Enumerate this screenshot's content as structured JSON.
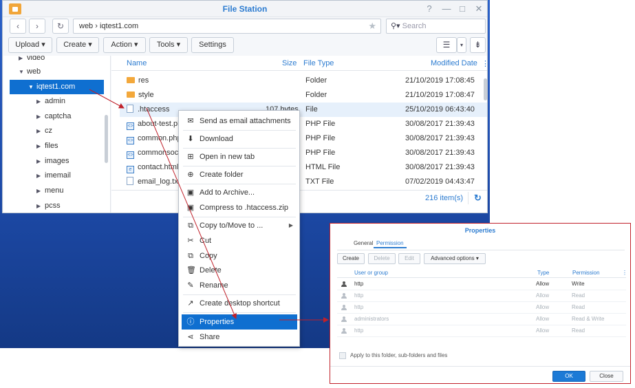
{
  "window": {
    "title": "File Station",
    "controls": [
      "?",
      "—",
      "□",
      "✕"
    ]
  },
  "nav": {
    "back_icon": "chevron-left-icon",
    "forward_icon": "chevron-right-icon",
    "refresh_icon": "refresh-icon",
    "path": "web  ›  iqtest1.com",
    "search_placeholder": "Search"
  },
  "toolbar": {
    "upload": "Upload ▾",
    "create": "Create ▾",
    "action": "Action ▾",
    "tools": "Tools ▾",
    "settings": "Settings"
  },
  "sidebar": {
    "items": [
      {
        "label": "video",
        "level": 1,
        "expanded": false
      },
      {
        "label": "web",
        "level": 1,
        "expanded": true
      },
      {
        "label": "iqtest1.com",
        "level": 2,
        "expanded": true,
        "selected": true
      },
      {
        "label": "admin",
        "level": 3
      },
      {
        "label": "captcha",
        "level": 3
      },
      {
        "label": "cz",
        "level": 3
      },
      {
        "label": "files",
        "level": 3
      },
      {
        "label": "images",
        "level": 3
      },
      {
        "label": "imemail",
        "level": 3
      },
      {
        "label": "menu",
        "level": 3
      },
      {
        "label": "pcss",
        "level": 3
      }
    ]
  },
  "filelist": {
    "headers": {
      "name": "Name",
      "size": "Size",
      "type": "File Type",
      "modified": "Modified Date"
    },
    "rows": [
      {
        "name": "res",
        "size": "",
        "type": "Folder",
        "modified": "21/10/2019 17:08:45",
        "icon": "folder-icon"
      },
      {
        "name": "style",
        "size": "",
        "type": "Folder",
        "modified": "21/10/2019 17:08:47",
        "icon": "folder-icon"
      },
      {
        "name": ".htaccess",
        "size": "107 bytes",
        "type": "File",
        "modified": "25/10/2019 06:43:40",
        "icon": "file-icon",
        "highlighted": true
      },
      {
        "name": "about-test.php",
        "size": "",
        "type": "PHP File",
        "modified": "30/08/2017 21:39:43",
        "icon": "php-file-icon"
      },
      {
        "name": "common.php",
        "size": "",
        "type": "PHP File",
        "modified": "30/08/2017 21:39:43",
        "icon": "php-file-icon"
      },
      {
        "name": "commonsocial",
        "size": "",
        "type": "PHP File",
        "modified": "30/08/2017 21:39:43",
        "icon": "php-file-icon"
      },
      {
        "name": "contact.html",
        "size": "",
        "type": "HTML File",
        "modified": "30/08/2017 21:39:43",
        "icon": "html-file-icon"
      },
      {
        "name": "email_log.txt",
        "size": "",
        "type": "TXT File",
        "modified": "07/02/2019 04:43:47",
        "icon": "text-file-icon"
      }
    ],
    "count": "216 item(s)"
  },
  "context_menu": {
    "items": [
      {
        "label": "Send as email attachments",
        "icon": "mail-icon"
      },
      {
        "label": "Download",
        "icon": "download-icon"
      },
      {
        "label": "Open in new tab",
        "icon": "new-tab-icon"
      },
      {
        "label": "Create folder",
        "icon": "add-folder-icon"
      },
      {
        "label": "Add to Archive...",
        "icon": "archive-icon"
      },
      {
        "label": "Compress to .htaccess.zip",
        "icon": "compress-icon"
      },
      {
        "label": "Copy to/Move to ...",
        "icon": "copy-move-icon",
        "submenu": true
      },
      {
        "label": "Cut",
        "icon": "cut-icon"
      },
      {
        "label": "Copy",
        "icon": "copy-icon"
      },
      {
        "label": "Delete",
        "icon": "delete-icon"
      },
      {
        "label": "Rename",
        "icon": "rename-icon"
      },
      {
        "label": "Create desktop shortcut",
        "icon": "shortcut-icon"
      },
      {
        "label": "Properties",
        "icon": "info-icon",
        "selected": true
      },
      {
        "label": "Share",
        "icon": "share-icon"
      }
    ]
  },
  "properties": {
    "title": "Properties",
    "tabs": [
      "General",
      "Permission"
    ],
    "active_tab": "Permission",
    "buttons": {
      "create": "Create",
      "delete": "Delete",
      "edit": "Edit",
      "advanced": "Advanced options ▾"
    },
    "headers": {
      "user": "User or group",
      "type": "Type",
      "permission": "Permission"
    },
    "rows": [
      {
        "user": "http",
        "type": "Allow",
        "permission": "Write",
        "inherited": false
      },
      {
        "user": "http",
        "type": "Allow",
        "permission": "Read",
        "inherited": true
      },
      {
        "user": "http",
        "type": "Allow",
        "permission": "Read",
        "inherited": true
      },
      {
        "user": "administrators",
        "type": "Allow",
        "permission": "Read & Write",
        "inherited": true
      },
      {
        "user": "http",
        "type": "Allow",
        "permission": "Read",
        "inherited": true
      }
    ],
    "apply_label": "Apply to this folder, sub-folders and files",
    "ok": "OK",
    "close": "Close"
  },
  "colors": {
    "accent": "#2b7bd0",
    "selection": "#0f6fd0",
    "annotation": "#c0202a"
  }
}
